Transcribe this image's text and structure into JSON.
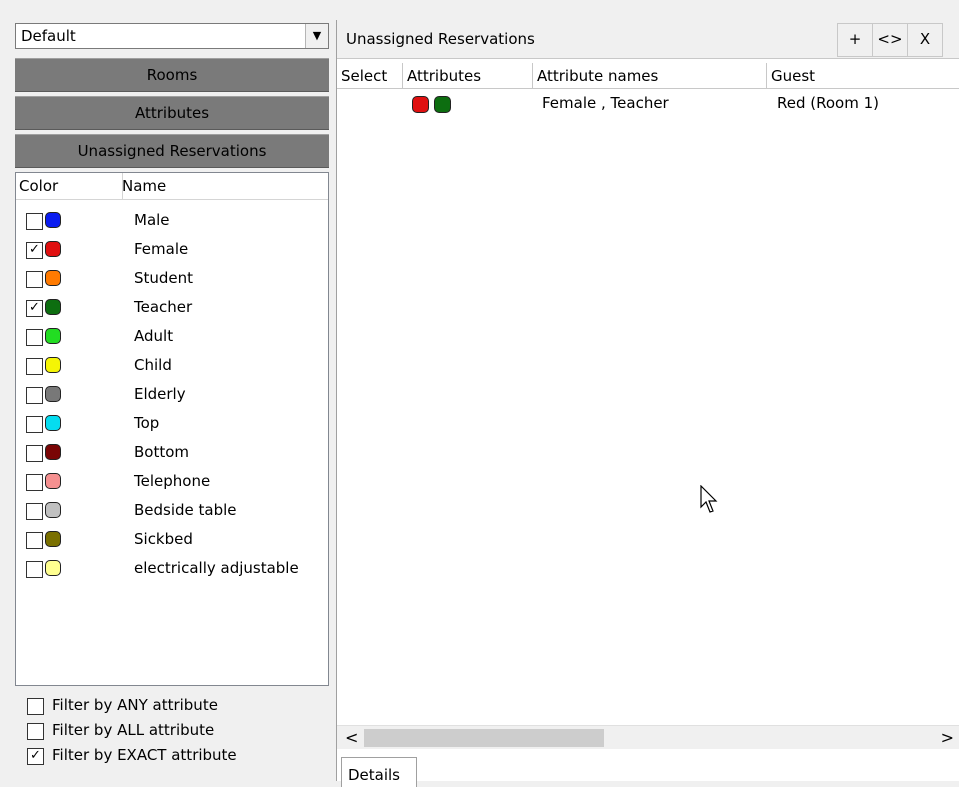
{
  "left": {
    "preset": "Default",
    "sections": [
      "Rooms",
      "Attributes",
      "Unassigned Reservations"
    ],
    "list_headers": [
      "Color",
      "Name"
    ],
    "attributes": [
      {
        "name": "Male",
        "color": "#0a1cf0",
        "checked": false
      },
      {
        "name": "Female",
        "color": "#e01010",
        "checked": true
      },
      {
        "name": "Student",
        "color": "#ff7a00",
        "checked": false
      },
      {
        "name": "Teacher",
        "color": "#0d6e10",
        "checked": true
      },
      {
        "name": "Adult",
        "color": "#22dd22",
        "checked": false
      },
      {
        "name": "Child",
        "color": "#f5f505",
        "checked": false
      },
      {
        "name": "Elderly",
        "color": "#787878",
        "checked": false
      },
      {
        "name": "Top",
        "color": "#05dcf0",
        "checked": false
      },
      {
        "name": "Bottom",
        "color": "#7a0505",
        "checked": false
      },
      {
        "name": "Telephone",
        "color": "#f59090",
        "checked": false
      },
      {
        "name": "Bedside table",
        "color": "#c0c0c0",
        "checked": false
      },
      {
        "name": "Sickbed",
        "color": "#7a7000",
        "checked": false
      },
      {
        "name": "electrically adjustable",
        "color": "#ffff90",
        "checked": false
      }
    ],
    "filters": [
      {
        "label": "Filter by ANY attribute",
        "checked": false
      },
      {
        "label": "Filter by ALL attribute",
        "checked": false
      },
      {
        "label": "Filter by EXACT attribute",
        "checked": true
      }
    ]
  },
  "right": {
    "title": "Unassigned Reservations",
    "buttons": {
      "add": "+",
      "swap": "<>",
      "close": "X"
    },
    "columns": [
      "Select",
      "Attributes",
      "Attribute names",
      "Guest"
    ],
    "rows": [
      {
        "attribute_colors": [
          "#e01010",
          "#0d6e10"
        ],
        "attribute_names": "Female , Teacher",
        "guest": "Red (Room 1)"
      }
    ],
    "scroll": {
      "left": "<",
      "right": ">"
    },
    "tab": "Details"
  }
}
